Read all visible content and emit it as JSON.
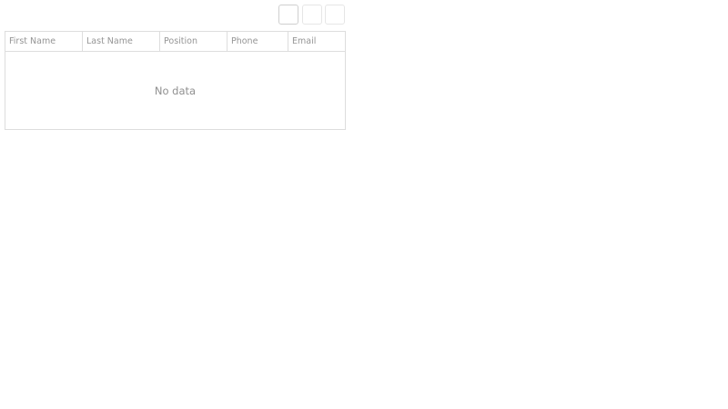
{
  "toolbar": {
    "buttons": [
      {
        "icon": "add-icon"
      },
      {
        "icon": "save-icon"
      },
      {
        "icon": "cancel-icon"
      }
    ]
  },
  "grid": {
    "columns": [
      "First Name",
      "Last Name",
      "Position",
      "Phone",
      "Email"
    ],
    "empty_text": "No data"
  }
}
